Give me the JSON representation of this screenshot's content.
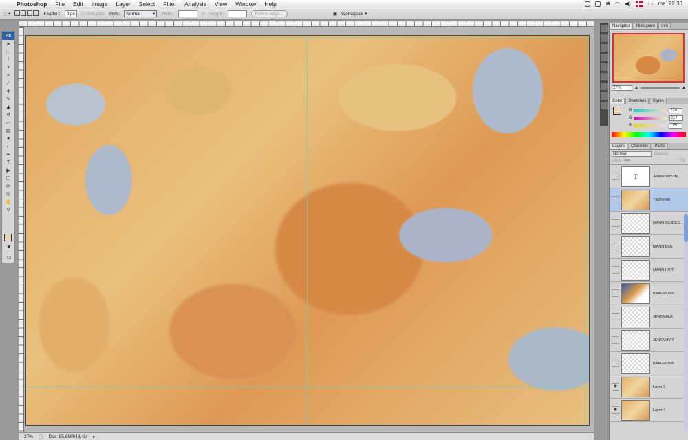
{
  "menubar": {
    "app": "Photoshop",
    "items": [
      "File",
      "Edit",
      "Image",
      "Layer",
      "Select",
      "Filter",
      "Analysis",
      "View",
      "Window",
      "Help"
    ],
    "clock": "ma. 22.36"
  },
  "options": {
    "feather_label": "Feather:",
    "feather_value": "0 px",
    "antialias": "Anti-alias",
    "style_label": "Style:",
    "style_value": "Normal",
    "width_label": "Width:",
    "height_label": "Height:",
    "refine_edge": "Refine Edge...",
    "workspace": "Workspace ▾"
  },
  "toolbox": {
    "logo": "Ps"
  },
  "status": {
    "zoom": "27%",
    "doc": "Doc: 85,6M/948,4M"
  },
  "navigator": {
    "tabs": [
      "Navigator",
      "Histogram",
      "Info"
    ],
    "zoom": "27%"
  },
  "color": {
    "tabs": [
      "Color",
      "Swatches",
      "Styles"
    ],
    "channels": [
      {
        "label": "R",
        "value": "228",
        "grad": "linear-gradient(90deg,#00d9c3,#ffd9c3)"
      },
      {
        "label": "G",
        "value": "217",
        "grad": "linear-gradient(90deg,#e400c3,#e4ffc3)"
      },
      {
        "label": "B",
        "value": "195",
        "grad": "linear-gradient(90deg,#e4d900,#e4d9ff)"
      }
    ]
  },
  "layers": {
    "tabs": [
      "Layers",
      "Channels",
      "Paths"
    ],
    "blend": "Normal",
    "opacity_label": "Opacity:",
    "lock_label": "Lock:",
    "fill_label": "Fill:",
    "items": [
      {
        "name": "-Fisker som de...",
        "thumb": "t",
        "selected": false,
        "visible": false
      },
      {
        "name": "TEGNING",
        "thumb": "art",
        "selected": true,
        "visible": false
      },
      {
        "name": "MANN SKJEGG...",
        "thumb": "check",
        "selected": false,
        "visible": false
      },
      {
        "name": "MANN BLÅ",
        "thumb": "check",
        "selected": false,
        "visible": false
      },
      {
        "name": "MANN HVIT",
        "thumb": "check",
        "selected": false,
        "visible": false
      },
      {
        "name": "BAKGRUNN",
        "thumb": "blue",
        "selected": false,
        "visible": false
      },
      {
        "name": "JENTA BLÅ",
        "thumb": "check",
        "selected": false,
        "visible": false
      },
      {
        "name": "JENTA HVIT",
        "thumb": "check",
        "selected": false,
        "visible": false
      },
      {
        "name": "BAKGRUNN",
        "thumb": "check",
        "selected": false,
        "visible": false
      },
      {
        "name": "Layer 5",
        "thumb": "art",
        "selected": false,
        "visible": true
      },
      {
        "name": "Layer 4",
        "thumb": "art",
        "selected": false,
        "visible": true
      }
    ]
  }
}
